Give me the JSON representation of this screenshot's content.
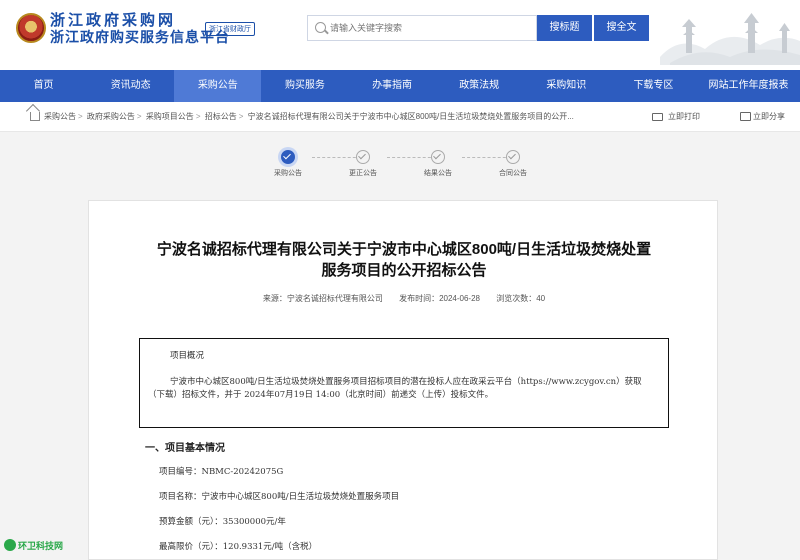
{
  "header": {
    "site_name_line1": "浙江政府采购网",
    "site_name_line2": "浙江政府购买服务信息平台",
    "dept_tag": "浙江省财政厅",
    "search_placeholder": "请输入关键字搜索",
    "search_title_button": "搜标题",
    "search_full_button": "搜全文"
  },
  "nav": {
    "items": [
      "首页",
      "资讯动态",
      "采购公告",
      "购买服务",
      "办事指南",
      "政策法规",
      "采购知识",
      "下载专区",
      "网站工作年度报表"
    ],
    "active_index": 2
  },
  "breadcrumb": {
    "items": [
      "采购公告",
      "政府采购公告",
      "采购项目公告",
      "招标公告",
      "宁波名诚招标代理有限公司关于宁波市中心城区800吨/日生活垃圾焚烧处置服务项目的公开..."
    ],
    "print_label": "立即打印",
    "share_label": "立即分享"
  },
  "steps": [
    {
      "label": "采购公告",
      "active": true
    },
    {
      "label": "更正公告",
      "active": false
    },
    {
      "label": "结果公告",
      "active": false
    },
    {
      "label": "合同公告",
      "active": false
    }
  ],
  "article": {
    "title_line1": "宁波名诚招标代理有限公司关于宁波市中心城区800吨/日生活垃圾焚烧处置",
    "title_line2": "服务项目的公开招标公告",
    "source": "来源：宁波名诚招标代理有限公司",
    "publish_time": "发布时间：2024-06-28",
    "views": "浏览次数：40",
    "summary_title": "项目概况",
    "summary_body": "宁波市中心城区800吨/日生活垃圾焚烧处置服务项目招标项目的潜在投标人应在政采云平台（https://www.zcygov.cn）获取（下载）招标文件，并于 2024年07月19日 14:00（北京时间）前递交（上传）投标文件。",
    "section1_title": "一、项目基本情况",
    "fields": [
      "项目编号：NBMC-20242075G",
      "项目名称：宁波市中心城区800吨/日生活垃圾焚烧处置服务项目",
      "预算金额（元）：35300000元/年",
      "最高限价（元）：120.9331元/吨（含税）"
    ]
  },
  "watermark": "环卫科技网"
}
